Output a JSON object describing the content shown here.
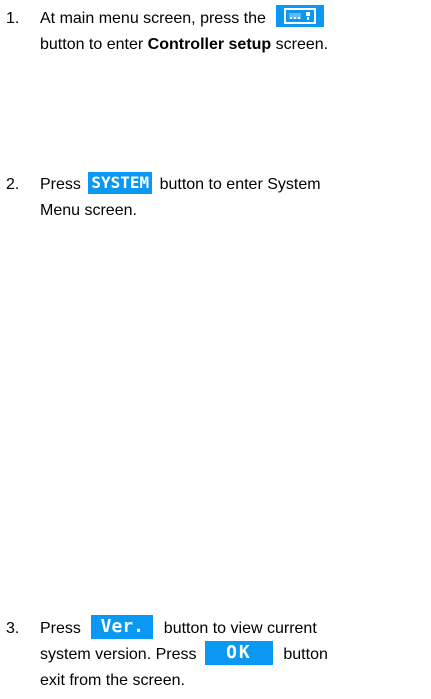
{
  "steps": [
    {
      "number": "1.",
      "line1_before": "At main menu screen, press the ",
      "icon": "controller-setup-icon",
      "line2_before": "button to enter ",
      "line2_bold": "Controller setup",
      "line2_after": " screen."
    },
    {
      "number": "2.",
      "line1_before": "Press ",
      "key_label": "SYSTEM",
      "line1_after": " button to enter System",
      "line2": "Menu screen."
    },
    {
      "number": "3.",
      "line1_before": "Press ",
      "key_label": "Ver.",
      "line1_after": " button to view current",
      "line2_before": "system version.  Press ",
      "key2_label": "OK",
      "line2_after": " button",
      "line3": "exit from the screen."
    }
  ],
  "colors": {
    "key_background": "#0a98f2",
    "key_text": "#ffffff"
  }
}
